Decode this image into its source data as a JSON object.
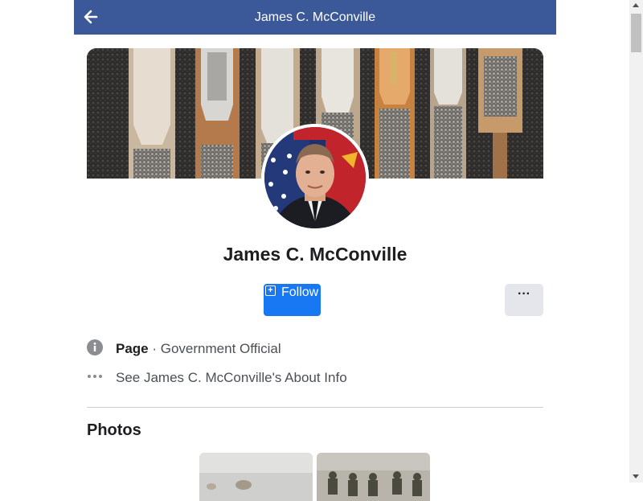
{
  "header": {
    "title": "James C. McConville",
    "back_icon": "arrow-left-icon",
    "background": "#3b5998"
  },
  "profile": {
    "name": "James C. McConville",
    "follow_label": "Follow",
    "more_label": "···",
    "accent": "#1877f2"
  },
  "info": {
    "category_strong": "Page",
    "category_sep": " · ",
    "category_value": "Government Official",
    "about_link": "See James C. McConville's About Info"
  },
  "photos": {
    "title": "Photos"
  }
}
